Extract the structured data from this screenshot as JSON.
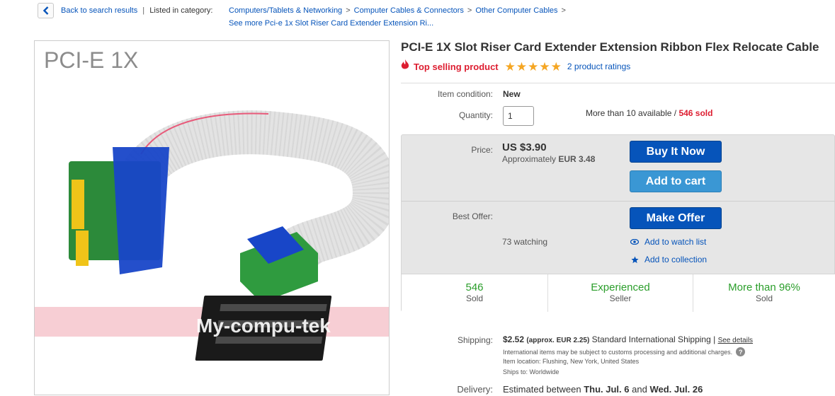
{
  "breadcrumb": {
    "back_label": "Back to search results",
    "listed_label": "Listed in category:",
    "categories": [
      "Computers/Tablets & Networking",
      "Computer Cables & Connectors",
      "Other Computer Cables"
    ],
    "separator": ">",
    "see_more": "See more Pci-e 1x Slot Riser Card Extender Extension Ri..."
  },
  "image": {
    "caption": "PCI-E 1X",
    "watermark": "My-compu-tek"
  },
  "product": {
    "title": "PCI-E 1X Slot Riser Card Extender Extension Ribbon Flex Relocate Cable",
    "top_selling": "Top selling product",
    "rating_stars": 5,
    "ratings_link": "2 product ratings"
  },
  "condition": {
    "label": "Item condition:",
    "value": "New"
  },
  "quantity": {
    "label": "Quantity:",
    "value": "1",
    "available": "More than 10 available /",
    "sold": "546 sold"
  },
  "price": {
    "label": "Price:",
    "value": "US $3.90",
    "approx_label": "Approximately",
    "approx_value": "EUR 3.48"
  },
  "buttons": {
    "buy_now": "Buy It Now",
    "add_to_cart": "Add to cart",
    "make_offer": "Make Offer"
  },
  "offer": {
    "label": "Best Offer:",
    "watching": "73 watching",
    "watch_list": "Add to watch list",
    "collection": "Add to collection"
  },
  "stats": [
    {
      "big": "546",
      "small": "Sold"
    },
    {
      "big": "Experienced",
      "small": "Seller"
    },
    {
      "big": "More than 96%",
      "small": "Sold"
    }
  ],
  "shipping": {
    "label": "Shipping:",
    "cost": "$2.52",
    "approx": "(approx. EUR 2.25)",
    "method": "Standard International Shipping |",
    "details_link": "See details",
    "note": "International items may be subject to customs processing and additional charges.",
    "location_label": "Item location:",
    "location": "Flushing, New York, United States",
    "ships_to_label": "Ships to:",
    "ships_to": "Worldwide"
  },
  "delivery": {
    "label": "Delivery:",
    "prefix": "Estimated between",
    "start": "Thu. Jul. 6",
    "and": "and",
    "end": "Wed. Jul. 26"
  },
  "colors": {
    "link": "#0654ba",
    "accent_red": "#dd1e31",
    "buy_blue": "#0654ba",
    "cart_blue": "#3a97d4",
    "stat_green": "#2b9e2b",
    "star": "#f5a623"
  }
}
